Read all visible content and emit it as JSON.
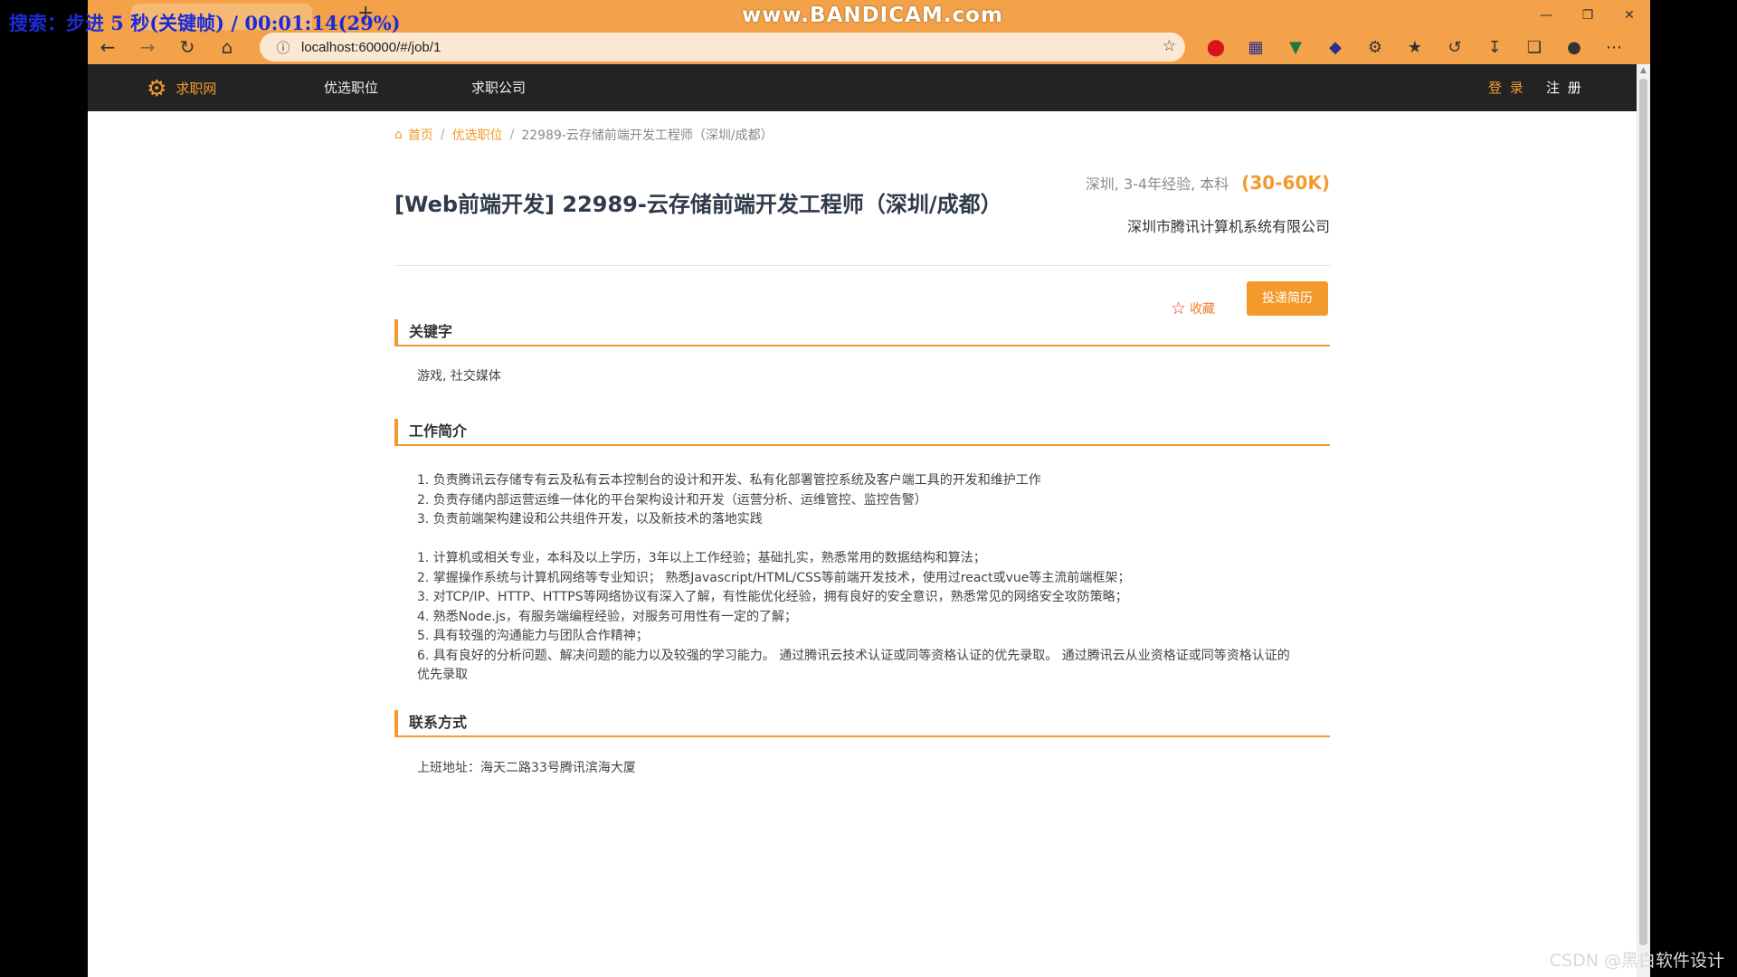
{
  "recorder": {
    "search_overlay": "搜索：步进 5 秒(关键帧) / 00:01:14(29%)",
    "watermark": "www.BANDICAM.com"
  },
  "csdn_watermark": "CSDN @黑白软件设计",
  "browser": {
    "url": "localhost:60000/#/job/1"
  },
  "site": {
    "brand": "求职网",
    "nav": [
      "优选职位",
      "求职公司"
    ],
    "login": "登 录",
    "register": "注 册"
  },
  "breadcrumb": {
    "home": "首页",
    "section": "优选职位",
    "current": "22989-云存储前端开发工程师（深圳/成都）"
  },
  "job": {
    "title": "[Web前端开发] 22989-云存储前端开发工程师（深圳/成都）",
    "requirements": "深圳, 3-4年经验, 本科",
    "salary": "(30-60K)",
    "company": "深圳市腾讯计算机系统有限公司",
    "favorite_label": "收藏",
    "apply_label": "投递简历"
  },
  "sections": {
    "keywords": {
      "title": "关键字",
      "text": "游戏, 社交媒体"
    },
    "description": {
      "title": "工作简介",
      "duties": [
        "1. 负责腾讯云存储专有云及私有云本控制台的设计和开发、私有化部署管控系统及客户端工具的开发和维护工作",
        "2. 负责存储内部运营运维一体化的平台架构设计和开发（运营分析、运维管控、监控告警）",
        "3. 负责前端架构建设和公共组件开发，以及新技术的落地实践"
      ],
      "requirements": [
        "1. 计算机或相关专业，本科及以上学历，3年以上工作经验；基础扎实，熟悉常用的数据结构和算法；",
        "2. 掌握操作系统与计算机网络等专业知识； 熟悉Javascript/HTML/CSS等前端开发技术，使用过react或vue等主流前端框架；",
        "3. 对TCP/IP、HTTP、HTTPS等网络协议有深入了解，有性能优化经验，拥有良好的安全意识，熟悉常见的网络安全攻防策略；",
        "4. 熟悉Node.js，有服务端编程经验，对服务可用性有一定的了解；",
        "5. 具有较强的沟通能力与团队合作精神；",
        "6. 具有良好的分析问题、解决问题的能力以及较强的学习能力。 通过腾讯云技术认证或同等资格认证的优先录取。 通过腾讯云从业资格证或同等资格认证的",
        "优先录取"
      ]
    },
    "contact": {
      "title": "联系方式",
      "text": "上班地址：海天二路33号腾讯滨海大厦"
    }
  }
}
